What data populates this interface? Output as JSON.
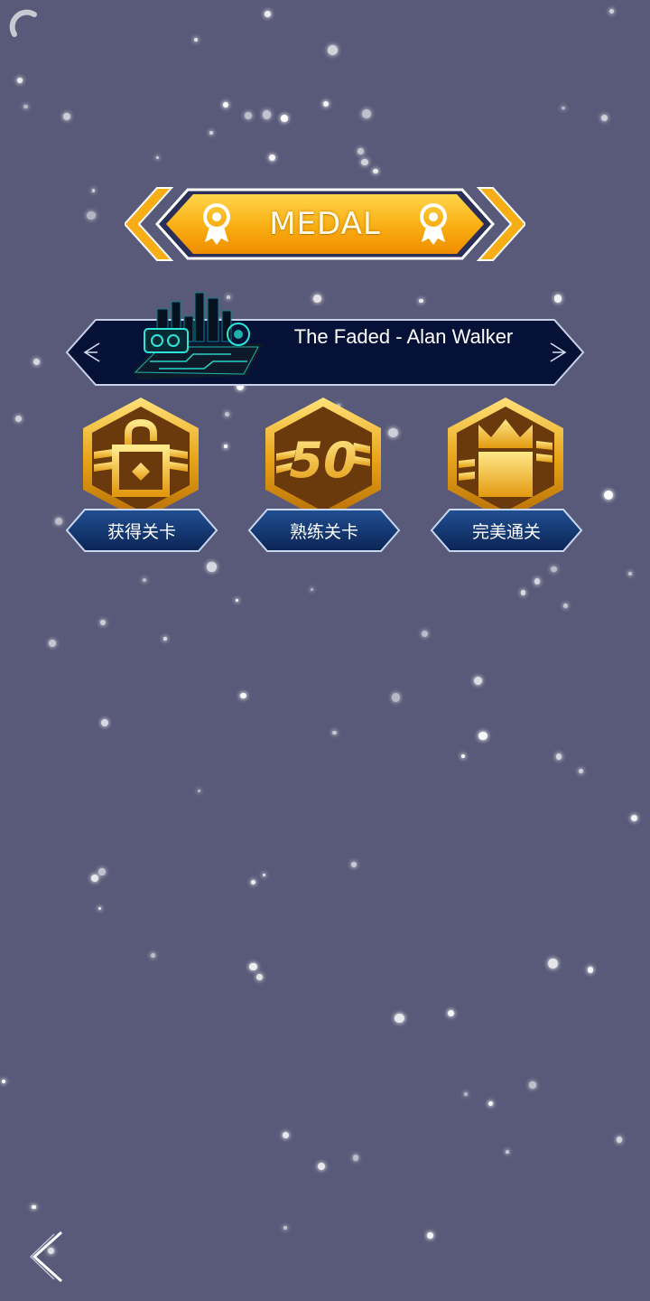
{
  "header": {
    "title": "MEDAL",
    "icon": "award-ribbon-icon"
  },
  "song": {
    "name": "The Faded - Alan Walker",
    "artwork": "circuit-city-artwork"
  },
  "medals": [
    {
      "label": "获得关卡",
      "icon": "unlock-lock-icon"
    },
    {
      "label": "熟练关卡",
      "icon": "fifty-badge-icon",
      "badge_text": "50"
    },
    {
      "label": "完美通关",
      "icon": "crown-icon"
    }
  ],
  "nav": {
    "back": "back-chevron-icon"
  },
  "colors": {
    "background": "#595a79",
    "gold": "#f7b21a",
    "navy": "#0a1640",
    "medal_brown": "#6a3a0c"
  }
}
